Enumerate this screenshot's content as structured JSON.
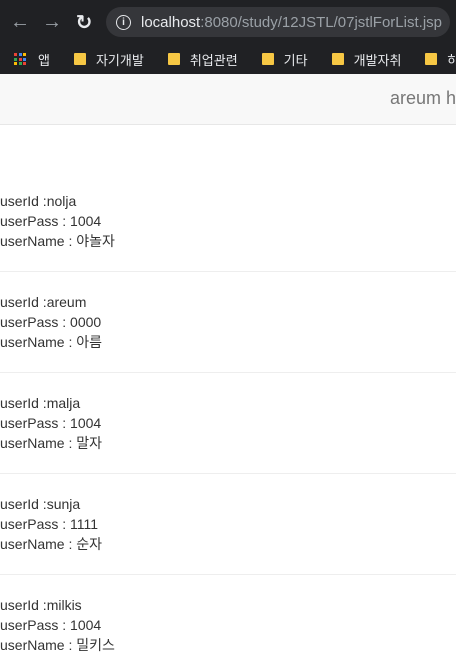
{
  "browser": {
    "url_host": "localhost",
    "url_rest": ":8080/study/12JSTL/07jstlForList.jsp",
    "bookmarks": [
      {
        "label": "앱"
      },
      {
        "label": "자기개발"
      },
      {
        "label": "취업관련"
      },
      {
        "label": "기타"
      },
      {
        "label": "개발자취"
      },
      {
        "label": "하루"
      }
    ]
  },
  "navbar": {
    "brand": "areum h"
  },
  "users": [
    {
      "id_line": "userId :nolja",
      "pass_line": "userPass : 1004",
      "name_line": "userName : 야놀자"
    },
    {
      "id_line": "userId :areum",
      "pass_line": "userPass : 0000",
      "name_line": "userName : 아름"
    },
    {
      "id_line": "userId :malja",
      "pass_line": "userPass : 1004",
      "name_line": "userName : 말자"
    },
    {
      "id_line": "userId :sunja",
      "pass_line": "userPass : 1111",
      "name_line": "userName : 순자"
    },
    {
      "id_line": "userId :milkis",
      "pass_line": "userPass : 1004",
      "name_line": "userName : 밀키스"
    }
  ]
}
